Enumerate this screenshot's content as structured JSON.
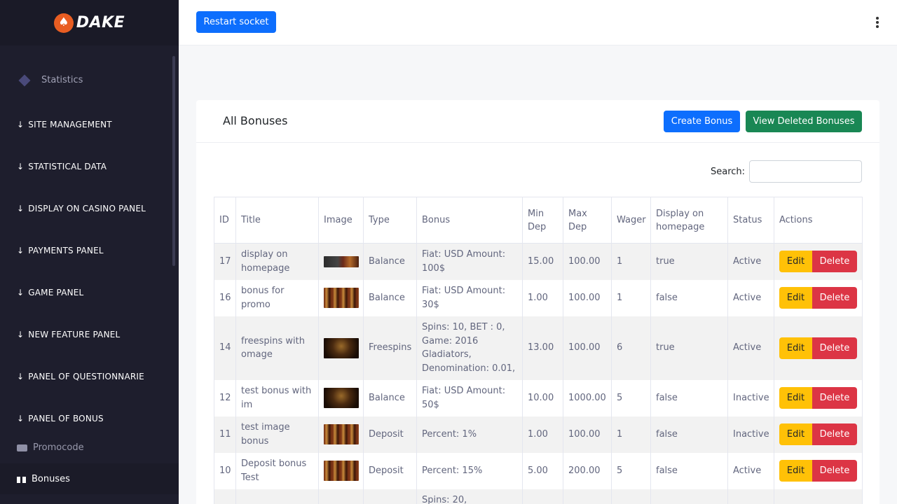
{
  "brand": {
    "name": "DAKE",
    "logo_icon": "spade-icon",
    "logo_color": "#e85d22"
  },
  "sidebar": {
    "statistics_label": "Statistics",
    "sections": [
      {
        "label": "SITE MANAGEMENT"
      },
      {
        "label": "STATISTICAL DATA"
      },
      {
        "label": "DISPLAY ON CASINO PANEL"
      },
      {
        "label": "PAYMENTS PANEL"
      },
      {
        "label": "GAME PANEL"
      },
      {
        "label": "NEW FEATURE PANEL"
      },
      {
        "label": "PANEL OF QUESTIONNARIE"
      },
      {
        "label": "PANEL OF BONUS"
      }
    ],
    "sub_items": [
      {
        "label": "Promocode",
        "icon": "ticket-icon"
      },
      {
        "label": "Bonuses",
        "icon": "gift-icon",
        "active": true
      }
    ]
  },
  "header": {
    "restart_label": "Restart socket",
    "menu_icon": "kebab-menu-icon"
  },
  "card": {
    "title": "All Bonuses",
    "create_label": "Create Bonus",
    "view_deleted_label": "View Deleted Bonuses",
    "search_label": "Search:",
    "search_value": ""
  },
  "table": {
    "columns": [
      "ID",
      "Title",
      "Image",
      "Type",
      "Bonus",
      "Min Dep",
      "Max Dep",
      "Wager",
      "Display on homepage",
      "Status",
      "Actions"
    ],
    "edit_label": "Edit",
    "delete_label": "Delete",
    "rows": [
      {
        "id": "17",
        "title": "display on homepage",
        "type": "Balance",
        "bonus": "Fiat: USD Amount: 100$",
        "min_dep": "15.00",
        "max_dep": "100.00",
        "wager": "1",
        "display": "true",
        "status": "Active"
      },
      {
        "id": "16",
        "title": "bonus for promo",
        "type": "Balance",
        "bonus": "Fiat: USD Amount: 30$",
        "min_dep": "1.00",
        "max_dep": "100.00",
        "wager": "1",
        "display": "false",
        "status": "Active"
      },
      {
        "id": "14",
        "title": "freespins with omage",
        "type": "Freespins",
        "bonus": "Spins: 10, BET : 0, Game: 2016 Gladiators, Denomination: 0.01,",
        "min_dep": "13.00",
        "max_dep": "100.00",
        "wager": "6",
        "display": "true",
        "status": "Active"
      },
      {
        "id": "12",
        "title": "test bonus with im",
        "type": "Balance",
        "bonus": "Fiat: USD Amount: 50$",
        "min_dep": "10.00",
        "max_dep": "1000.00",
        "wager": "5",
        "display": "false",
        "status": "Inactive"
      },
      {
        "id": "11",
        "title": "test image bonus",
        "type": "Deposit",
        "bonus": "Percent: 1%",
        "min_dep": "1.00",
        "max_dep": "100.00",
        "wager": "1",
        "display": "false",
        "status": "Inactive"
      },
      {
        "id": "10",
        "title": "Deposit bonus Test",
        "type": "Deposit",
        "bonus": "Percent: 15%",
        "min_dep": "5.00",
        "max_dep": "200.00",
        "wager": "5",
        "display": "false",
        "status": "Active"
      },
      {
        "id": "",
        "title": "",
        "type": "",
        "bonus": "Spins: 20,",
        "min_dep": "",
        "max_dep": "",
        "wager": "",
        "display": "",
        "status": ""
      }
    ]
  },
  "colors": {
    "sidebar_bg": "#1e1e2d",
    "primary": "#0d6efd",
    "success": "#198754",
    "warning": "#ffc107",
    "danger": "#dc3545"
  }
}
